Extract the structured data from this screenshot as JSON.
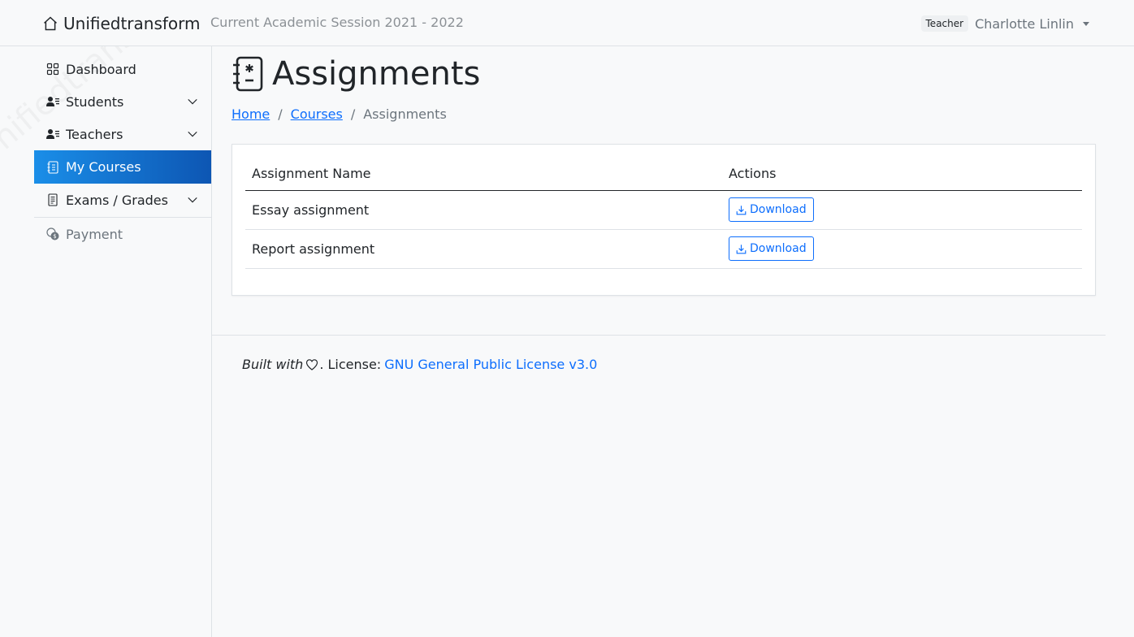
{
  "header": {
    "brand": "Unifiedtransform",
    "session": "Current Academic Session 2021 - 2022",
    "role": "Teacher",
    "user_name": "Charlotte Linlin"
  },
  "sidebar": {
    "watermark": "Unifiedtransform",
    "items": [
      {
        "label": "Dashboard"
      },
      {
        "label": "Students"
      },
      {
        "label": "Teachers"
      },
      {
        "label": "My Courses"
      },
      {
        "label": "Exams / Grades"
      },
      {
        "label": "Payment"
      }
    ]
  },
  "page": {
    "title": "Assignments",
    "breadcrumb": {
      "home": "Home",
      "courses": "Courses",
      "current": "Assignments",
      "separator": "/"
    }
  },
  "table": {
    "headers": [
      "Assignment Name",
      "Actions"
    ],
    "rows": [
      {
        "name": "Essay assignment",
        "action": "Download"
      },
      {
        "name": "Report assignment",
        "action": "Download"
      }
    ]
  },
  "footer": {
    "built_with": "Built with",
    "license_label": ". License:",
    "license_link": "GNU General Public License v3.0"
  },
  "colors": {
    "accent": "#0d6efd",
    "active_start": "#1a8ee8",
    "active_end": "#0d56b3"
  }
}
